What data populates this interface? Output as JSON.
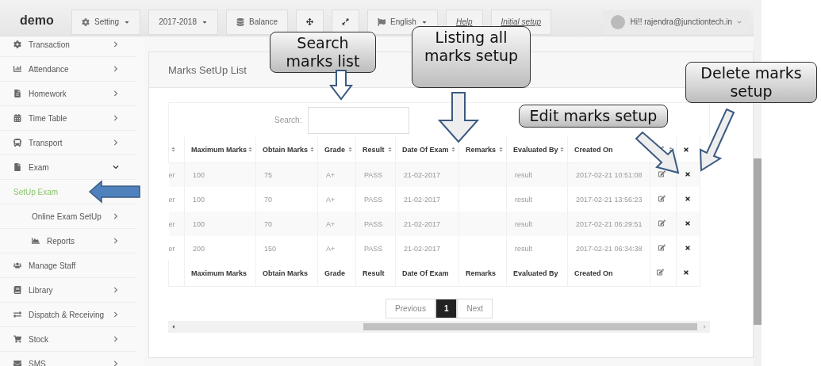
{
  "navbar": {
    "brand": "demo",
    "buttons": [
      {
        "kind": "dropdown",
        "label": "Setting"
      },
      {
        "kind": "dropdown",
        "label": "2017-2018"
      },
      {
        "kind": "plain",
        "label": "Balance"
      },
      {
        "kind": "icon"
      },
      {
        "kind": "icon"
      },
      {
        "kind": "dropdown",
        "label": "English"
      },
      {
        "kind": "link",
        "label": "Help"
      },
      {
        "kind": "link",
        "label": "Initial setup"
      }
    ],
    "user": "Hi!! rajendra@junctiontech.in"
  },
  "sidebar": {
    "items": [
      {
        "label": "Transaction",
        "kind": "group",
        "expanded": false,
        "selected": false
      },
      {
        "label": "Attendance",
        "kind": "group",
        "expanded": false,
        "selected": false
      },
      {
        "label": "Homework",
        "kind": "group",
        "expanded": false,
        "selected": false
      },
      {
        "label": "Time Table",
        "kind": "group",
        "expanded": false,
        "selected": false
      },
      {
        "label": "Transport",
        "kind": "group",
        "expanded": false,
        "selected": false
      },
      {
        "label": "Exam",
        "kind": "group",
        "expanded": true,
        "selected": false,
        "children": [
          {
            "label": "SetUp Exam",
            "kind": "link",
            "selected": true
          },
          {
            "label": "Online Exam SetUp",
            "kind": "group",
            "expanded": false,
            "selected": false
          },
          {
            "label": "Reports",
            "kind": "group",
            "expanded": false,
            "selected": false
          }
        ]
      },
      {
        "label": "Manage Staff",
        "kind": "link",
        "selected": false
      },
      {
        "label": "Library",
        "kind": "group",
        "expanded": false,
        "selected": false
      },
      {
        "label": "Dispatch & Receiving",
        "kind": "group",
        "expanded": false,
        "selected": false
      },
      {
        "label": "Stock",
        "kind": "group",
        "expanded": false,
        "selected": false
      },
      {
        "label": "SMS",
        "kind": "group",
        "expanded": false,
        "selected": false
      }
    ]
  },
  "panel": {
    "title": "Marks SetUp List",
    "search": {
      "label": "Search:"
    },
    "table": {
      "columns": [
        {
          "kind": "cut",
          "sortable": true
        },
        {
          "kind": "text",
          "label": "Maximum Marks",
          "sortable": true
        },
        {
          "kind": "text",
          "label": "Obtain Marks",
          "sortable": true
        },
        {
          "kind": "text",
          "label": "Grade",
          "sortable": true
        },
        {
          "kind": "text",
          "label": "Result",
          "sortable": true
        },
        {
          "kind": "text",
          "label": "Date Of Exam",
          "sortable": true
        },
        {
          "kind": "text",
          "label": "Remarks",
          "sortable": true
        },
        {
          "kind": "text",
          "label": "Evaluated By",
          "sortable": true
        },
        {
          "kind": "text",
          "label": "Created On",
          "sortable": false
        },
        {
          "kind": "edit",
          "sortable": true
        },
        {
          "kind": "delete",
          "sortable": false
        }
      ],
      "rows": [
        {
          "column_1": "er",
          "maximum_marks": "100",
          "obtain_marks": "75",
          "grade": "A+",
          "result": "PASS",
          "date_of_exam": "21-02-2017",
          "evaluated_by": "result",
          "created_on": "2017-02-21 10:51:08"
        },
        {
          "column_1": "er",
          "maximum_marks": "100",
          "obtain_marks": "70",
          "grade": "A+",
          "result": "PASS",
          "date_of_exam": "21-02-2017",
          "evaluated_by": "result",
          "created_on": "2017-02-21 13:56:23"
        },
        {
          "column_1": "er",
          "maximum_marks": "100",
          "obtain_marks": "70",
          "grade": "A+",
          "result": "PASS",
          "date_of_exam": "21-02-2017",
          "evaluated_by": "result",
          "created_on": "2017-02-21 06:29:51"
        },
        {
          "column_1": "er",
          "maximum_marks": "200",
          "obtain_marks": "150",
          "grade": "A+",
          "result": "PASS",
          "date_of_exam": "21-02-2017",
          "evaluated_by": "result",
          "created_on": "2017-02-21 06:34:38"
        }
      ],
      "footer": [
        "Maximum Marks",
        "Obtain Marks",
        "Grade",
        "Result",
        "Date Of Exam",
        "Remarks",
        "Evaluated By",
        "Created On"
      ]
    },
    "pagination": {
      "previous": "Previous",
      "pages": [
        {
          "label": "1",
          "selected": true
        }
      ],
      "next": "Next"
    }
  },
  "annotations": [
    "Search marks list",
    "Listing all marks setup",
    "Edit marks setup",
    "Delete marks setup"
  ]
}
